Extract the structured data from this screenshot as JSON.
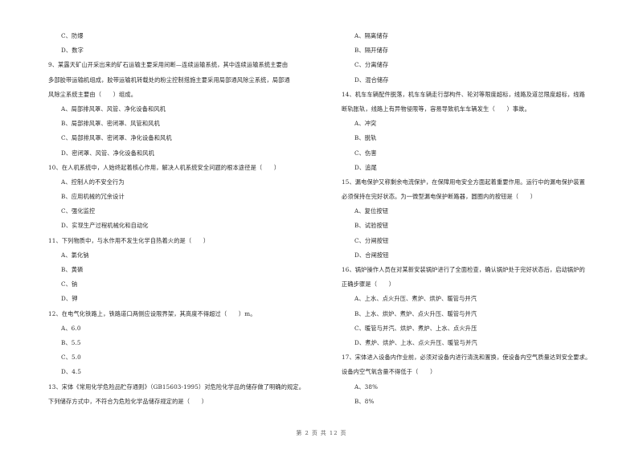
{
  "left_column": [
    {
      "type": "opt",
      "text": "C、防爆"
    },
    {
      "type": "opt",
      "text": "D、数字"
    },
    {
      "type": "q",
      "text": "9、某露天矿山开采出来的矿石运输主要采用间断—连续运输系统，其中连续运输系统主要由"
    },
    {
      "type": "q",
      "text": "多部胶带运输机组成，胶带运输机转载处的粉尘控制措施主要采用局部通风除尘系统，局部通"
    },
    {
      "type": "q",
      "text": "风除尘系统主要由（　　）组成。"
    },
    {
      "type": "opt",
      "text": "A、局部排风罩、风管、净化设备和风机"
    },
    {
      "type": "opt",
      "text": "B、局部排风罩、密闭罩、风管和风机"
    },
    {
      "type": "opt",
      "text": "C、局部排风罩、密闭罩、净化设备和风机"
    },
    {
      "type": "opt",
      "text": "D、密闭罩、风管、净化设备和风机"
    },
    {
      "type": "q",
      "text": "10、在人机系统中，人始终起着核心作用，解决人机系统安全问题的根本途径是（　　）"
    },
    {
      "type": "opt",
      "text": "A、控制人的不安全行为"
    },
    {
      "type": "opt",
      "text": "B、应用机械的冗余设计"
    },
    {
      "type": "opt",
      "text": "C、强化监控"
    },
    {
      "type": "opt",
      "text": "D、实现生产过程机械化和自动化"
    },
    {
      "type": "q",
      "text": "11、下列物质中，与水作用不发生化学自热着火的是（　　）"
    },
    {
      "type": "opt",
      "text": "A、氯化钠"
    },
    {
      "type": "opt",
      "text": "B、黄磷"
    },
    {
      "type": "opt",
      "text": "C、钠"
    },
    {
      "type": "opt",
      "text": "D、钾"
    },
    {
      "type": "q",
      "text": "12、在电气化铁路上，铁路道口两侧应设限界架，其高度不得超过（　　）m。"
    },
    {
      "type": "opt",
      "text": "A、6.0"
    },
    {
      "type": "opt",
      "text": "B、5.5"
    },
    {
      "type": "opt",
      "text": "C、5.0"
    },
    {
      "type": "opt",
      "text": "D、4.5"
    },
    {
      "type": "q",
      "text": "13、宋体《常用化学危险品贮存通则》（GB15603-1995）对危险化学品的储存做了明确的规定。"
    },
    {
      "type": "q",
      "text": "下列储存方式中，不符合为危险化学品储存规定的是（　　）"
    }
  ],
  "right_column": [
    {
      "type": "opt",
      "text": "A、隔离储存"
    },
    {
      "type": "opt",
      "text": "B、隔开储存"
    },
    {
      "type": "opt",
      "text": "C、分离储存"
    },
    {
      "type": "opt",
      "text": "D、混合储存"
    },
    {
      "type": "q",
      "text": "14、机车车辆配件脱落，机车车辆走行部构件、轮对等限度超标，线路及道岔限度超标，线路"
    },
    {
      "type": "q",
      "text": "断轨胀轨，线路上有异物侵限等，容易导致机车车辆发生（　　）事故。"
    },
    {
      "type": "opt",
      "text": "A、冲突"
    },
    {
      "type": "opt",
      "text": "B、脱轨"
    },
    {
      "type": "opt",
      "text": "C、伤害"
    },
    {
      "type": "opt",
      "text": "D、追尾"
    },
    {
      "type": "q",
      "text": "15、漏电保护又称剩余电流保护，在保障用电安全方面起着重要作用。运行中的漏电保护装置"
    },
    {
      "type": "q",
      "text": "必须保持在完好状态。为一微型漏电保护断路器，圆圈内的按钮是（　　）"
    },
    {
      "type": "opt",
      "text": "A、复位按钮"
    },
    {
      "type": "opt",
      "text": "B、试验按钮"
    },
    {
      "type": "opt",
      "text": "C、分闸按钮"
    },
    {
      "type": "opt",
      "text": "D、合闸按钮"
    },
    {
      "type": "q",
      "text": "16、锅炉操作人员在对某新安装锅炉进行了全面检查，确认锅炉处于完好状态后，启动锅炉的"
    },
    {
      "type": "q",
      "text": "正确步骤是（　　）"
    },
    {
      "type": "opt",
      "text": "A、上水、点火升压、煮炉、烘炉、暖管与并汽"
    },
    {
      "type": "opt",
      "text": "B、上水、烘炉、煮炉、点火升压、暖管与并汽"
    },
    {
      "type": "opt",
      "text": "C、暖管与并汽、烘炉、煮炉、上水、点火升压"
    },
    {
      "type": "opt",
      "text": "D、煮炉、烘炉、上水、点火升压、暖管与并汽"
    },
    {
      "type": "q",
      "text": "17、宋体进入设备内作业前，必须对设备内进行清洗和置换，使设备内空气质量达到安全要求。"
    },
    {
      "type": "q",
      "text": "设备内空气氧含量不得低于（　　）"
    },
    {
      "type": "opt",
      "text": "A、38%"
    },
    {
      "type": "opt",
      "text": "B、8%"
    }
  ],
  "footer": {
    "page_label": "第 2 页 共 12 页"
  }
}
